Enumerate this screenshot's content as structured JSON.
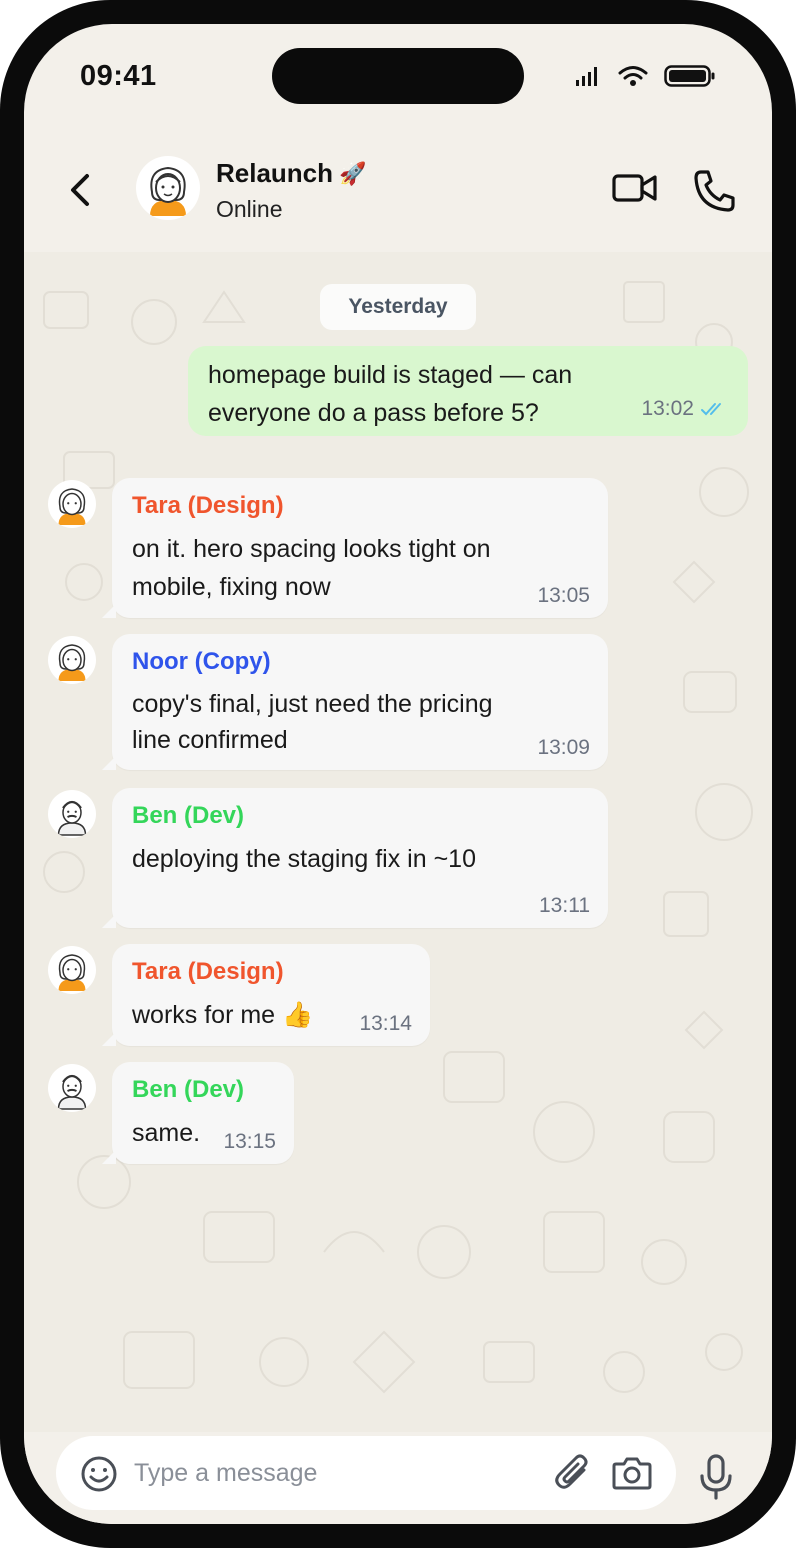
{
  "status_bar": {
    "time": "09:41",
    "icons": [
      "signal-icon",
      "wifi-icon",
      "battery-icon"
    ]
  },
  "header": {
    "title": "Relaunch",
    "title_emoji": "🚀",
    "subtitle": "Online",
    "icons": [
      "back-chevron-icon",
      "group-avatar",
      "video-camera-icon",
      "phone-icon"
    ]
  },
  "chat": {
    "date_separator": "Yesterday",
    "outgoing": {
      "text_line1": "homepage build is staged — can",
      "text_line2": "everyone do a pass before 5?",
      "time": "13:02",
      "status": "read",
      "tick_color": "#53bdeb"
    },
    "messages": [
      {
        "sender": "Tara (Design)",
        "sender_color": "#f0552d",
        "line1": "on it. hero spacing looks tight on",
        "line2": "mobile, fixing now",
        "time": "13:05"
      },
      {
        "sender": "Noor (Copy)",
        "sender_color": "#2f54eb",
        "line1": "copy's final, just need the pricing",
        "line2": "line confirmed",
        "time": "13:09"
      },
      {
        "sender": "Ben (Dev)",
        "sender_color": "#34d65a",
        "line1": "deploying the staging fix in ~10",
        "line2": "",
        "time": "13:11"
      },
      {
        "sender": "Tara (Design)",
        "sender_color": "#f0552d",
        "line1": "works for me 👍",
        "line2": "",
        "time": "13:14"
      },
      {
        "sender": "Ben (Dev)",
        "sender_color": "#34d65a",
        "line1": "same.",
        "line2": "",
        "time": "13:15"
      }
    ]
  },
  "composer": {
    "placeholder": "Type a message",
    "icons": [
      "emoji-icon",
      "paperclip-icon",
      "camera-icon",
      "microphone-icon"
    ]
  }
}
